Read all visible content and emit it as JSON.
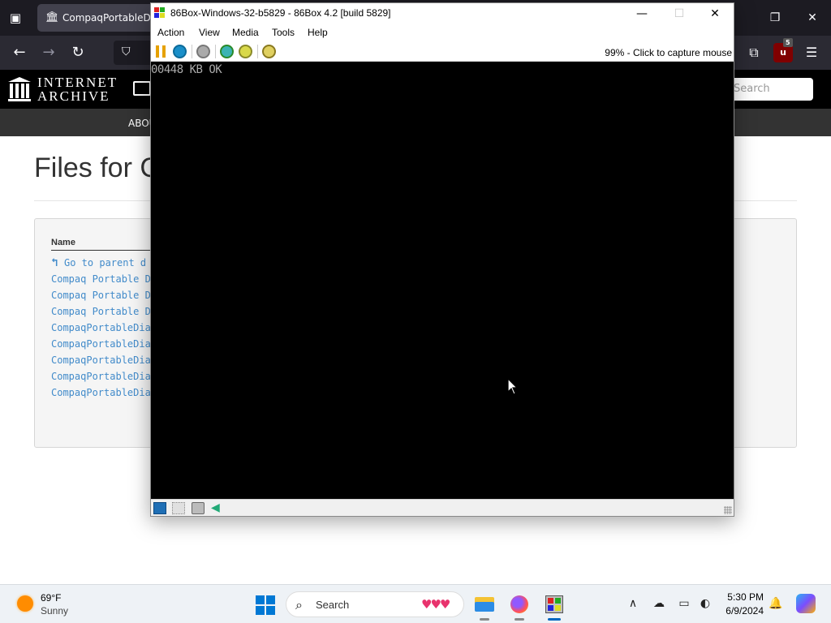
{
  "browser": {
    "tab_title": "CompaqPortableDia",
    "window_controls": {
      "minimize_icon": "minimize-icon",
      "restore_icon": "restore-icon",
      "close_icon": "close-icon"
    },
    "ublock_badge": "5"
  },
  "archive": {
    "logo_line1": "INTERNET",
    "logo_line2": "ARCHIVE",
    "search_placeholder": "Search",
    "subnav_item": "ABOU",
    "page_title": "Files for C",
    "column_name": "Name",
    "parent_link": "Go to parent d",
    "files": [
      "Compaq Portable Di",
      "Compaq Portable Di",
      "Compaq Portable Di",
      "CompaqPortableDiag",
      "CompaqPortableDiag",
      "CompaqPortableDiag",
      "CompaqPortableDiag",
      "CompaqPortableDiag"
    ]
  },
  "emulator": {
    "title": "86Box-Windows-32-b5829 - 86Box 4.2 [build 5829]",
    "menu": [
      "Action",
      "View",
      "Media",
      "Tools",
      "Help"
    ],
    "status_text": "99% - Click to capture mouse",
    "screen_text": "00448 KB OK",
    "colors": {
      "pause": "#e6a100",
      "reset": "#1a8fc9",
      "screen_bg": "#000000",
      "screen_fg": "#aaaaaa"
    }
  },
  "taskbar": {
    "weather_temp": "69°F",
    "weather_condition": "Sunny",
    "search_label": "Search",
    "time": "5:30 PM",
    "date": "6/9/2024"
  }
}
